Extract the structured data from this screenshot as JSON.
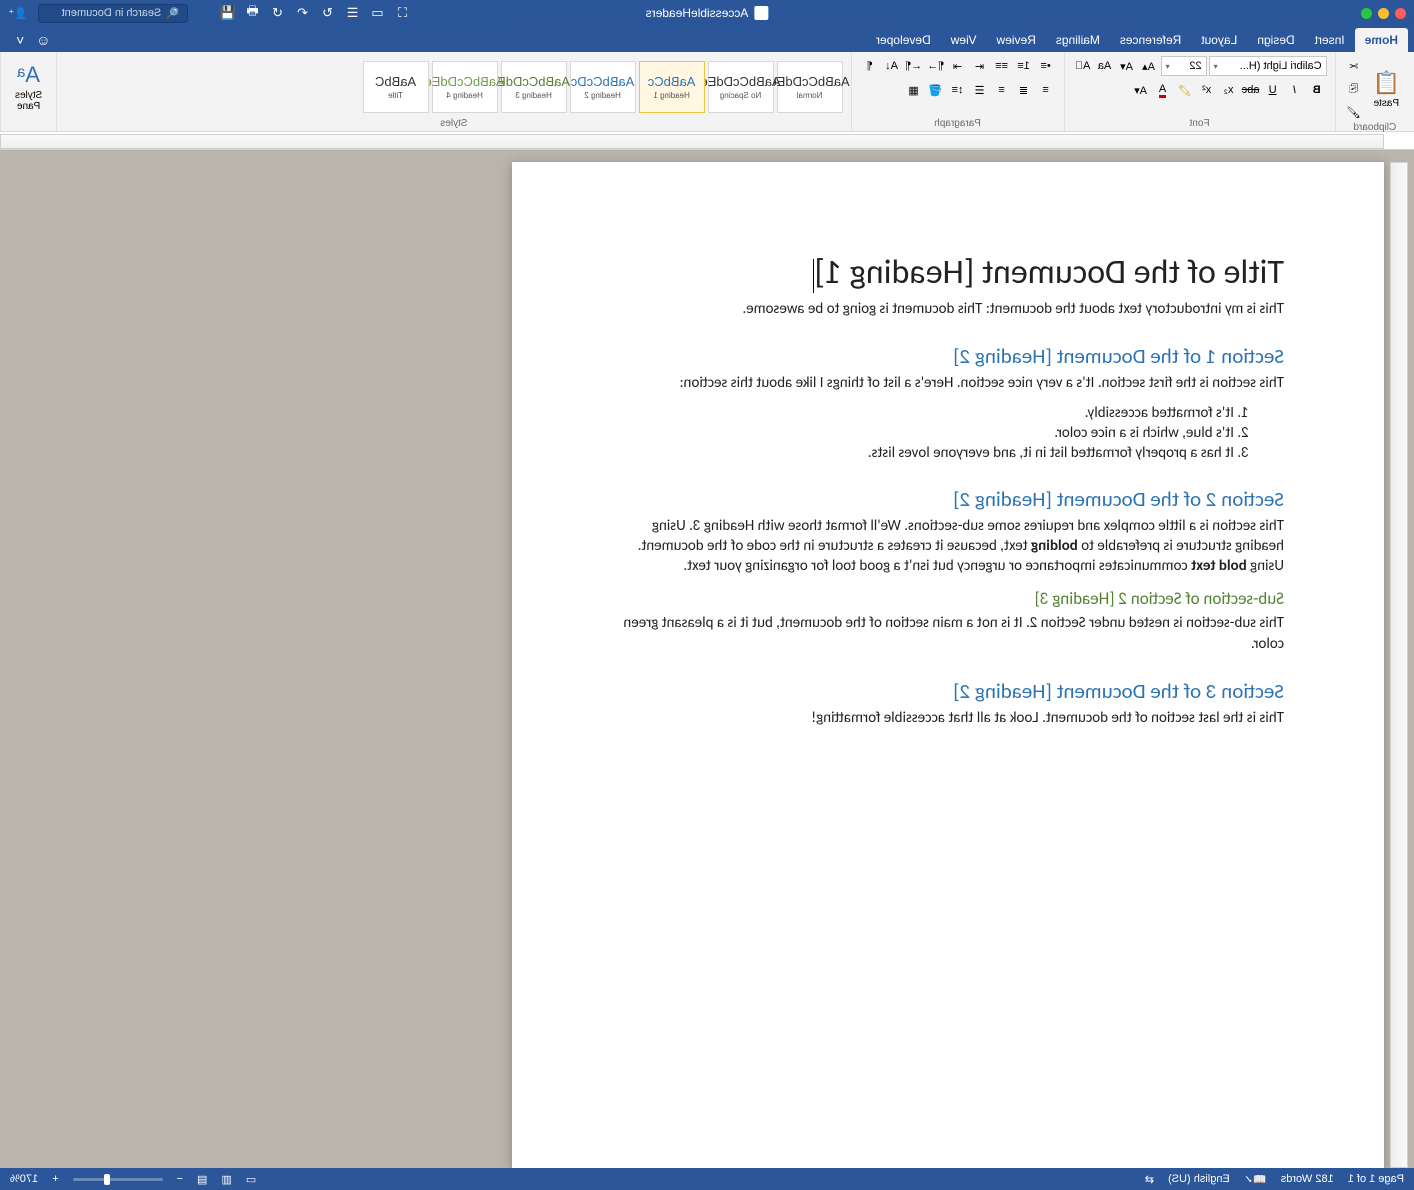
{
  "titlebar": {
    "document_name": "AccessibleHeaders",
    "search_placeholder": "Search in Document"
  },
  "tabs": {
    "items": [
      "Home",
      "Insert",
      "Design",
      "Layout",
      "References",
      "Mailings",
      "Review",
      "View",
      "Developer"
    ],
    "active": "Home"
  },
  "ribbon": {
    "clipboard": {
      "label": "Clipboard",
      "paste": "Paste"
    },
    "font": {
      "label": "Font",
      "name": "Calibri Light (H...",
      "size": "22",
      "bold": "B",
      "italic": "I",
      "underline": "U",
      "strike": "abc"
    },
    "paragraph": {
      "label": "Paragraph"
    },
    "styles": {
      "label": "Styles",
      "pane": "Styles\nPane",
      "tiles": [
        {
          "preview": "AaBbCcDdEe",
          "name": "Normal",
          "color": "#333"
        },
        {
          "preview": "AaBbCcDdEe",
          "name": "No Spacing",
          "color": "#333"
        },
        {
          "preview": "AaBbCc",
          "name": "Heading 1",
          "color": "#2e74b5",
          "active": true
        },
        {
          "preview": "AaBbCcDc",
          "name": "Heading 2",
          "color": "#2e74b5"
        },
        {
          "preview": "AaBbCcDdE",
          "name": "Heading 3",
          "color": "#548235"
        },
        {
          "preview": "AaBbCcDdEe",
          "name": "Heading 4",
          "color": "#6f9e49"
        },
        {
          "preview": "AaBbC",
          "name": "Title",
          "color": "#333"
        }
      ]
    }
  },
  "document": {
    "h1": "Title of the Document [Heading 1]",
    "intro": "This is my introductory text about the document: This document is going to be awesome.",
    "s1_h2": "Section 1 of the Document [Heading 2]",
    "s1_p": "This section is the first section. It's a very nice section. Here's a list of things I like about this section:",
    "s1_li1": "It's formatted accessibly.",
    "s1_li2": "It's blue, which is a nice color.",
    "s1_li3": "It has a properly formatted list in it, and everyone loves lists.",
    "s2_h2": "Section 2 of the Document [Heading 2]",
    "s2_p_a": "This section is a little complex and requires some sub-sections. We'll format those with Heading 3. Using heading structure is preferable to ",
    "s2_bold1": "bolding",
    "s2_p_b": " text, because it creates a structure in the code of the document. Using ",
    "s2_bold2": "bold text",
    "s2_p_c": " communicates importance or urgency but isn't a good tool for organizing your text.",
    "s2_h3": "Sub-section of Section 2 [Heading 3]",
    "s2_sub_p": "This sub-section is nested under Section 2. It is not a main section of the document, but it is a pleasant green color.",
    "s3_h2": "Section 3 of the Document [Heading 2]",
    "s3_p": "This is the last section of the document. Look at all that accessible formatting!"
  },
  "statusbar": {
    "page": "Page 1 of 1",
    "words": "182 Words",
    "language": "English (US)",
    "zoom": "170%"
  }
}
